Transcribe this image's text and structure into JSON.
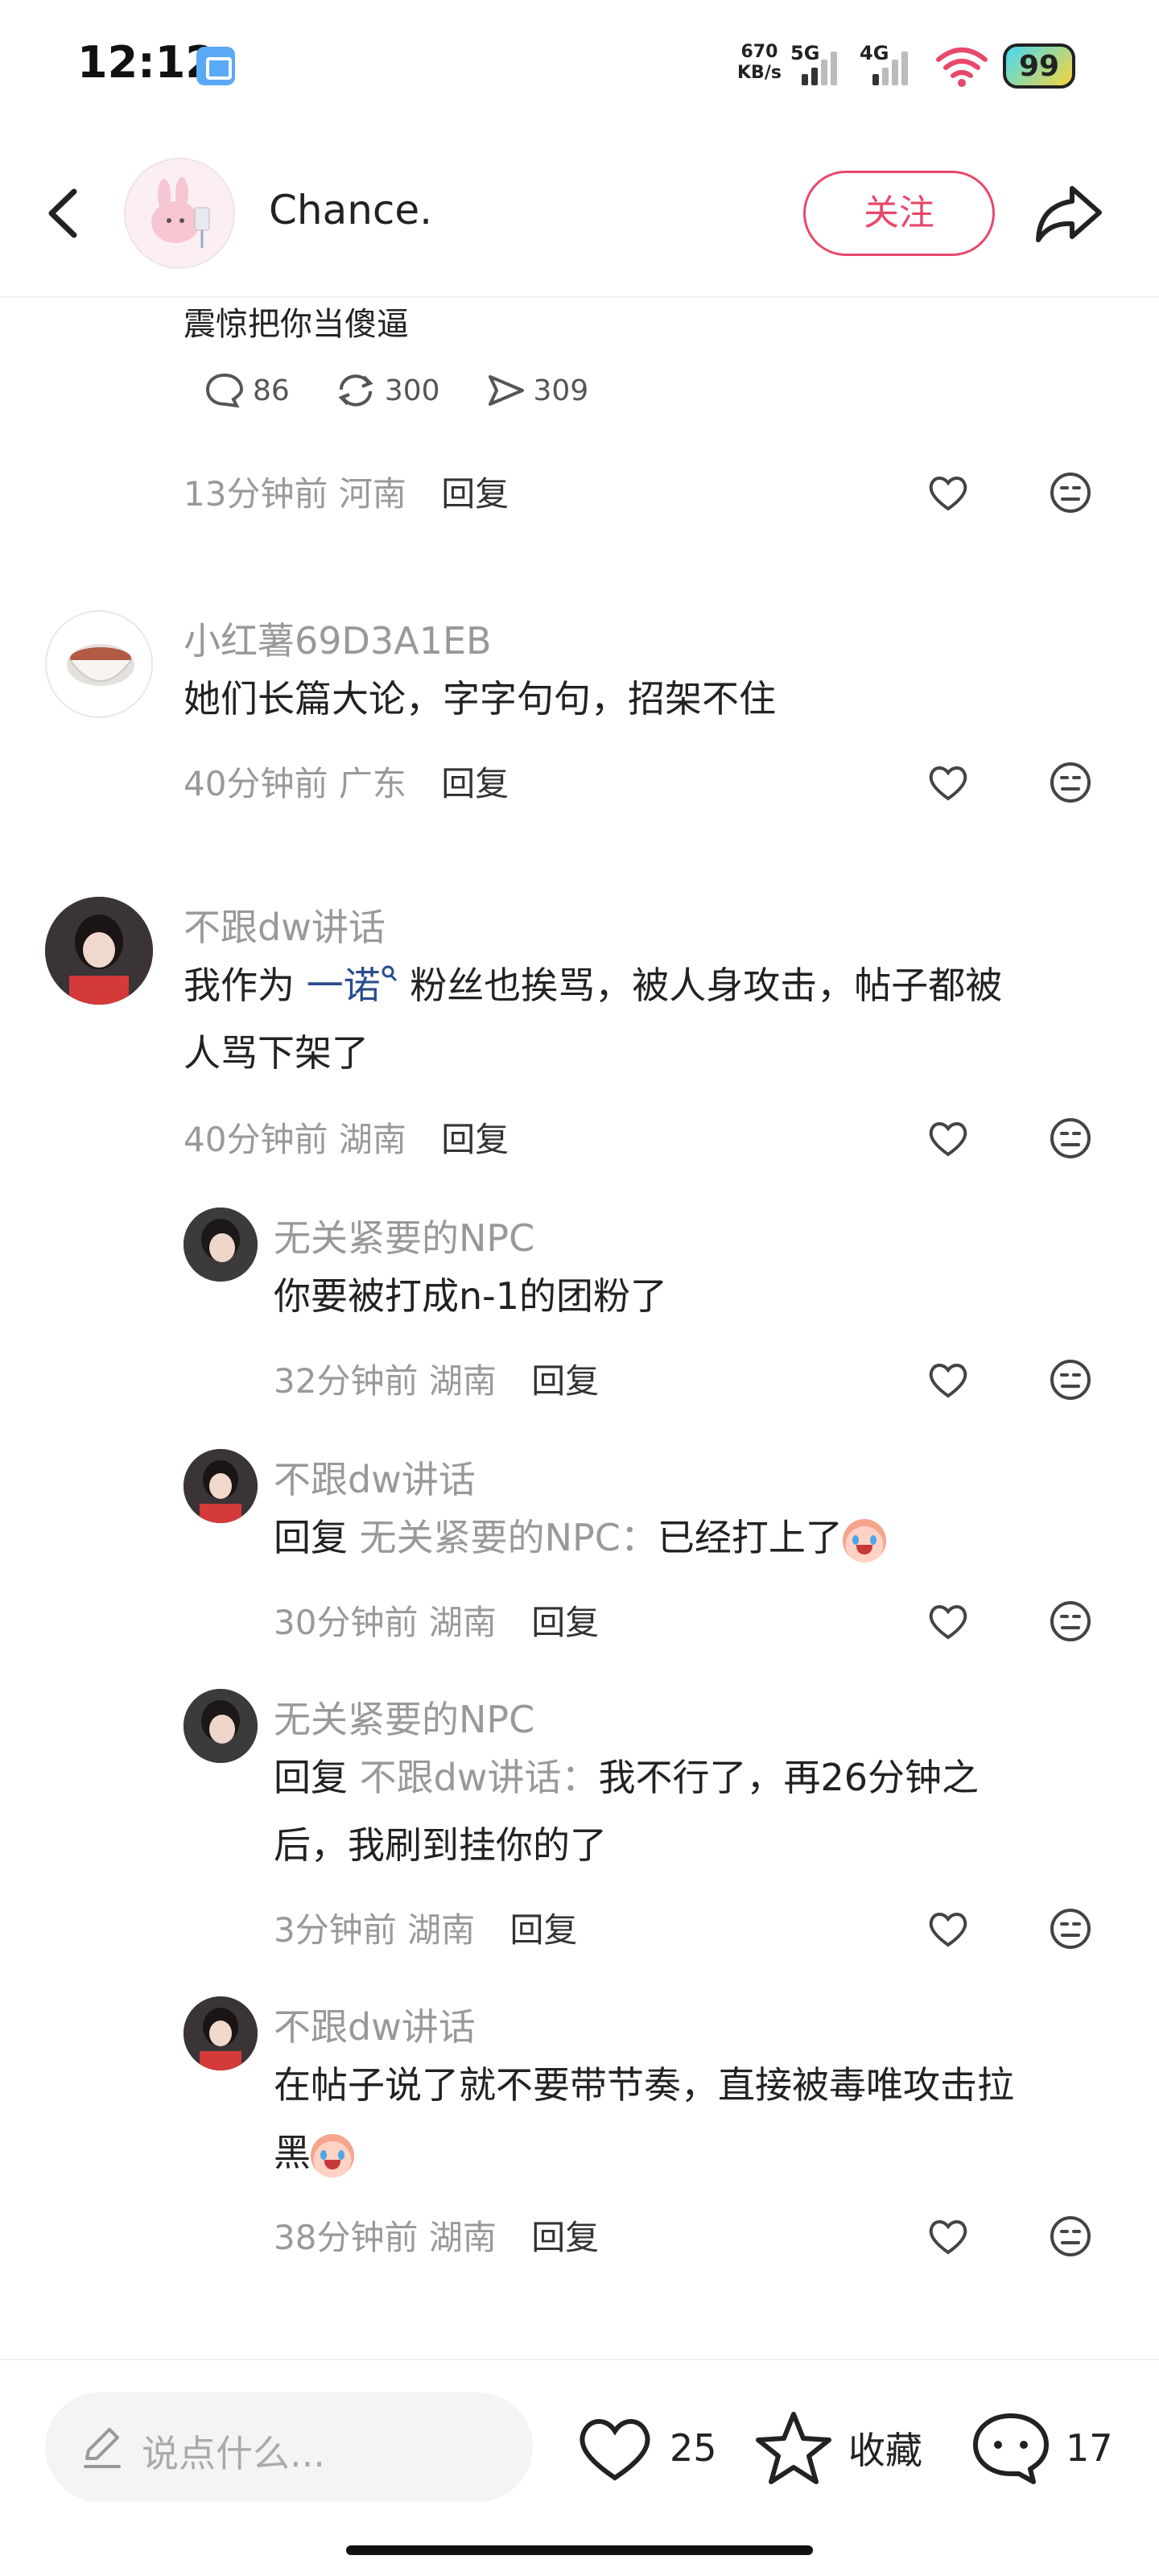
{
  "status_bar": {
    "time": "12:12",
    "speed_value": "670",
    "speed_unit": "KB/s",
    "net1": "5G",
    "net2": "4G",
    "battery": "99"
  },
  "header": {
    "username": "Chance.",
    "follow_label": "关注"
  },
  "previous_comment": {
    "text_fragment": "震惊把你当傻逼",
    "comments_count": "86",
    "reposts_count": "300",
    "shares_count": "309",
    "time": "13分钟前",
    "location": "河南",
    "reply_label": "回复"
  },
  "comments": [
    {
      "username": "小红薯69D3A1EB",
      "text": "她们长篇大论，字字句句，招架不住",
      "time": "40分钟前",
      "location": "广东",
      "reply_label": "回复"
    },
    {
      "username": "不跟dw讲话",
      "text_before": "我作为 ",
      "link_text": "一诺",
      "text_after_line1": " 粉丝也挨骂，被人身攻击，帖子都被",
      "text_line2": "人骂下架了",
      "time": "40分钟前",
      "location": "湖南",
      "reply_label": "回复",
      "replies": [
        {
          "username": "无关紧要的NPC",
          "text": "你要被打成n-1的团粉了",
          "time": "32分钟前",
          "location": "湖南",
          "reply_label": "回复"
        },
        {
          "username": "不跟dw讲话",
          "prefix": "回复",
          "mention": "无关紧要的NPC：",
          "text": "已经打上了",
          "time": "30分钟前",
          "location": "湖南",
          "reply_label": "回复"
        },
        {
          "username": "无关紧要的NPC",
          "prefix": "回复",
          "mention": "不跟dw讲话：",
          "text_line1": "我不行了，再26分钟之",
          "text_line2": "后，我刷到挂你的了",
          "time": "3分钟前",
          "location": "湖南",
          "reply_label": "回复"
        },
        {
          "username": "不跟dw讲话",
          "text_line1": "在帖子说了就不要带节奏，直接被毒唯攻击拉",
          "text_line2": "黑",
          "time": "38分钟前",
          "location": "湖南",
          "reply_label": "回复"
        }
      ]
    }
  ],
  "bottom_bar": {
    "input_placeholder": "说点什么...",
    "likes_count": "25",
    "collect_label": "收藏",
    "comments_count": "17"
  },
  "colors": {
    "accent": "#e8486a",
    "link": "#2a4d8c",
    "muted": "#999999"
  }
}
